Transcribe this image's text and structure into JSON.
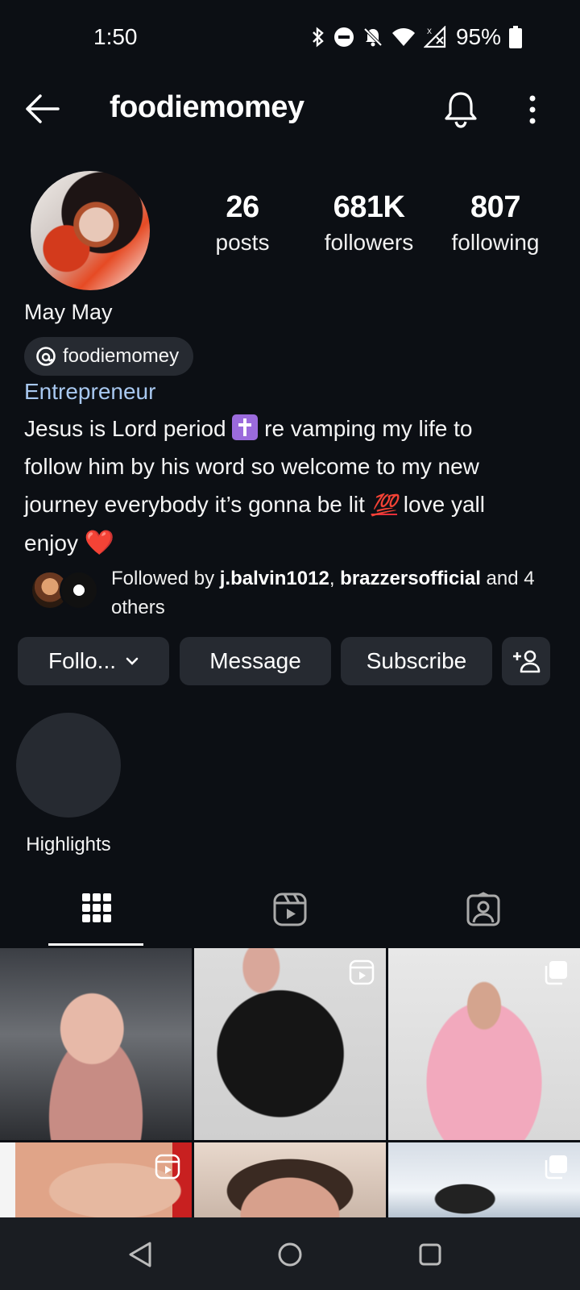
{
  "status_bar": {
    "time": "1:50",
    "battery": "95%",
    "icons": [
      "bluetooth-icon",
      "do-not-disturb-icon",
      "notifications-off-icon",
      "wifi-icon",
      "no-signal-icon",
      "battery-icon"
    ]
  },
  "header": {
    "username": "foodiemomey",
    "back_icon": "arrow-left-icon",
    "bell_icon": "bell-icon",
    "more_icon": "more-vertical-icon"
  },
  "stats": [
    {
      "value": "26",
      "label": "posts"
    },
    {
      "value": "681K",
      "label": "followers"
    },
    {
      "value": "807",
      "label": "following"
    }
  ],
  "profile": {
    "name": "May May",
    "threads_handle": "foodiemomey",
    "category": "Entrepreneur",
    "bio_line1_a": "Jesus is Lord period ",
    "bio_line1_b": " re vamping my life to",
    "bio_line2": "follow him by his word  so welcome to my new",
    "bio_line3_a": "journey everybody it’s gonna be lit ",
    "bio_emoji_100": "💯",
    "bio_line3_b": " love yall",
    "bio_line4_a": "enjoy ",
    "bio_emoji_heart": "❤️"
  },
  "followed_by": {
    "prefix": "Followed by ",
    "user1": "j.balvin1012",
    "separator": ", ",
    "user2": "brazzersofficial",
    "suffix": " and 4 others"
  },
  "actions": {
    "follow": "Follo...",
    "message": "Message",
    "subscribe": "Subscribe",
    "add_user_icon": "add-person-icon"
  },
  "highlights": {
    "label": "Highlights"
  },
  "tabs": [
    {
      "icon": "grid-icon",
      "selected": true
    },
    {
      "icon": "reels-icon",
      "selected": false
    },
    {
      "icon": "tagged-icon",
      "selected": false
    }
  ],
  "accent_colors": {
    "background": "#0c0f14",
    "button": "#262a31",
    "category_link": "#a8c8f0",
    "heart": "#e8303a"
  }
}
